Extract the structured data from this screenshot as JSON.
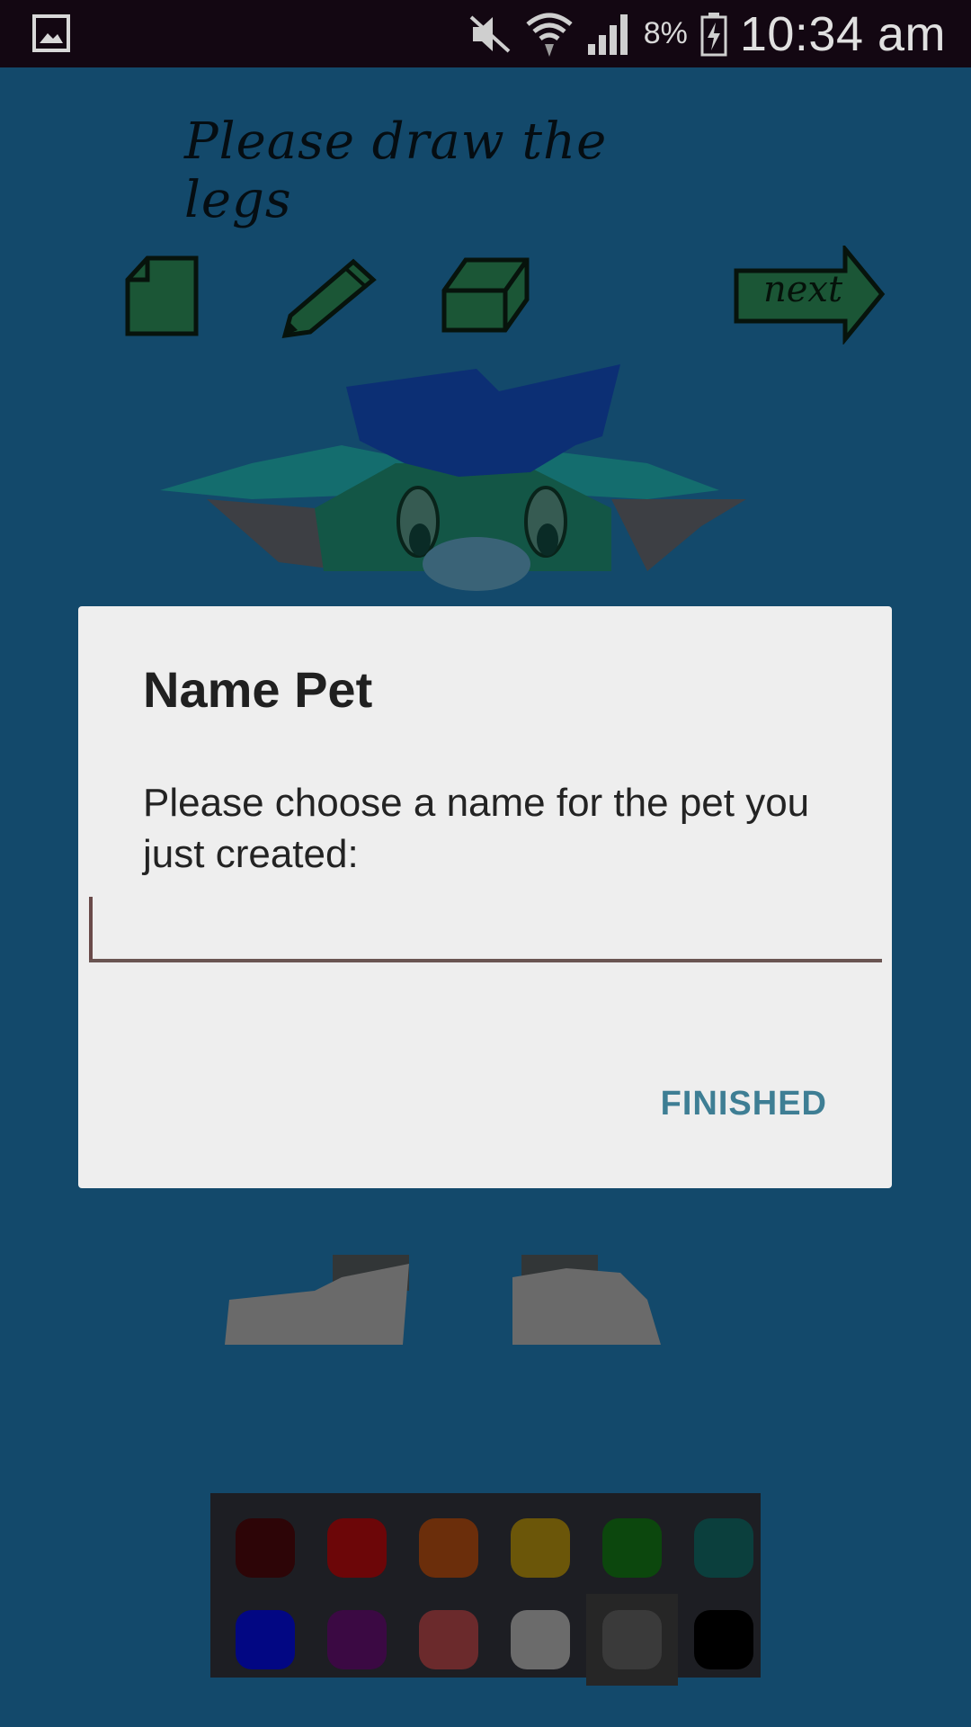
{
  "status_bar": {
    "gallery_icon": "image-icon",
    "mute_icon": "mute-icon",
    "wifi_icon": "wifi-icon",
    "signal_icon": "signal-icon",
    "battery_percent": "8%",
    "battery_icon": "battery-charging-icon",
    "time": "10:34 am"
  },
  "app": {
    "instruction": "Please draw the legs",
    "tools": [
      "new-page-icon",
      "pencil-icon",
      "eraser-icon"
    ],
    "next_label": "next",
    "palette": {
      "colors": [
        "#2d0507",
        "#6c0608",
        "#6b2e0b",
        "#6b5609",
        "#0c470d",
        "#0b3f3d",
        "#020783",
        "#3b0943",
        "#6b2a2c",
        "#6b6b6b",
        "#3a3a3a",
        "#000000"
      ],
      "selected_index": 10
    }
  },
  "dialog": {
    "title": "Name Pet",
    "message": "Please choose a name for the pet you just created:",
    "input_value": "",
    "input_placeholder": "",
    "finished_label": "FINISHED"
  },
  "colors": {
    "background": "#13496b",
    "dialog_bg": "#eeeeee",
    "accent": "#3e7e94",
    "input_underline": "#6a5552"
  }
}
